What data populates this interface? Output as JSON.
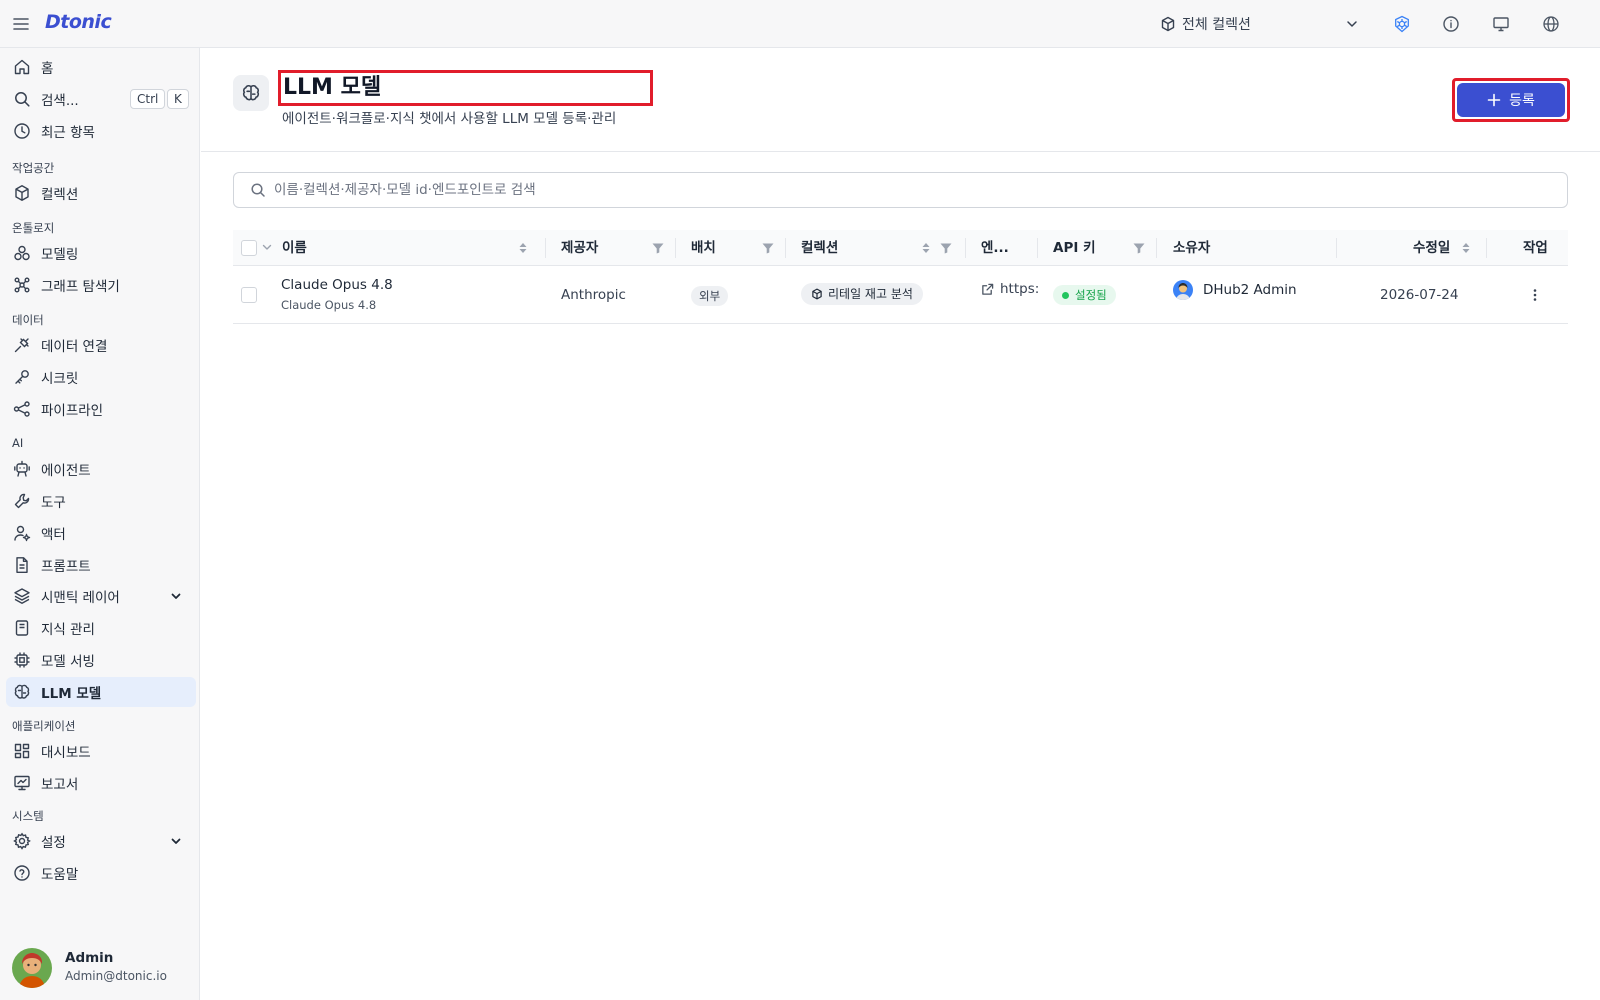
{
  "topbar": {
    "logo": "Dtonic",
    "collection_selector": "전체 컬렉션"
  },
  "sidebar": {
    "home": "홈",
    "search": "검색...",
    "shortcut_ctrl": "Ctrl",
    "shortcut_k": "K",
    "recent": "최근 항목",
    "sections": {
      "workspace": "작업공간",
      "ontology": "온톨로지",
      "data": "데이터",
      "ai": "AI",
      "apps": "애플리케이션",
      "system": "시스템"
    },
    "items": {
      "collections": "컬렉션",
      "modeling": "모델링",
      "graph_explorer": "그래프 탐색기",
      "data_connections": "데이터 연결",
      "secrets": "시크릿",
      "pipelines": "파이프라인",
      "agents": "에이전트",
      "tools": "도구",
      "actors": "액터",
      "prompts": "프롬프트",
      "semantic_layer": "시맨틱 레이어",
      "knowledge": "지식 관리",
      "model_serving": "모델 서빙",
      "llm_models": "LLM 모델",
      "dashboards": "대시보드",
      "reports": "보고서",
      "settings": "설정",
      "help": "도움말"
    },
    "user": {
      "name": "Admin",
      "email": "Admin@dtonic.io"
    }
  },
  "page": {
    "title": "LLM 모델",
    "subtitle": "에이전트·워크플로·지식 챗에서 사용할 LLM 모델 등록·관리",
    "add_button": "등록",
    "search_placeholder": "이름·컬렉션·제공자·모델 id·엔드포인트로 검색"
  },
  "table": {
    "columns": {
      "name": "이름",
      "provider": "제공자",
      "deployment": "배치",
      "collection": "컬렉션",
      "endpoint": "엔...",
      "api_key": "API 키",
      "owner": "소유자",
      "modified": "수정일",
      "actions": "작업"
    },
    "rows": [
      {
        "name": "Claude Opus 4.8",
        "model_id": "Claude Opus 4.8",
        "provider": "Anthropic",
        "deployment": "외부",
        "collection": "리테일 재고 분석",
        "endpoint": "https:",
        "api_key": "설정됨",
        "owner": "DHub2 Admin",
        "modified": "2026-07-24"
      }
    ]
  },
  "colors": {
    "accent": "#3b4fd1",
    "highlight_box": "#e11d2b",
    "status_ok": "#16a34a",
    "active_nav_bg": "#e6eefc"
  }
}
